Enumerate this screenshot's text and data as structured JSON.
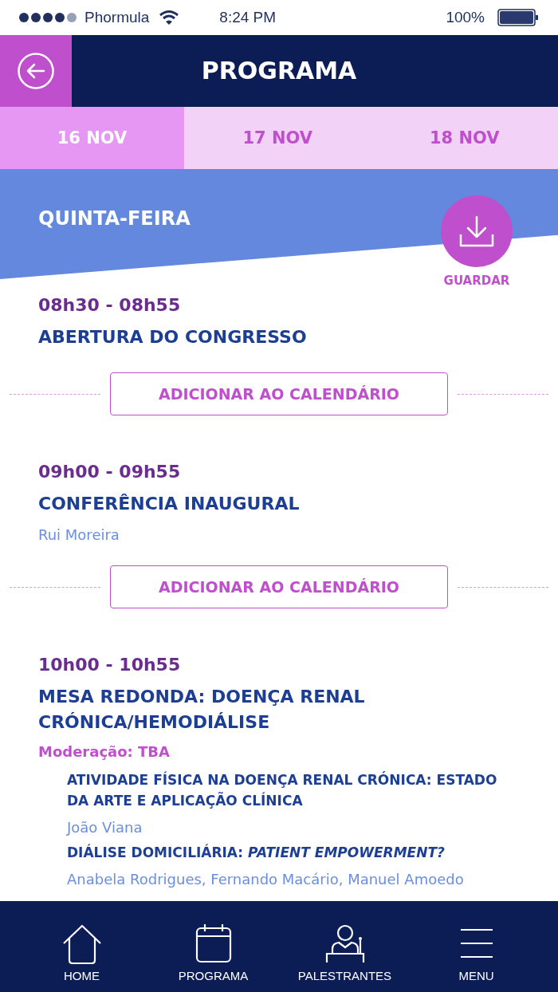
{
  "status_bar": {
    "carrier": "Phormula",
    "time": "8:24 PM",
    "battery": "100%"
  },
  "header": {
    "title": "PROGRAMA"
  },
  "tabs": [
    {
      "label": "16 NOV",
      "selected": true
    },
    {
      "label": "17 NOV",
      "selected": false
    },
    {
      "label": "18 NOV",
      "selected": false
    }
  ],
  "day": {
    "label": "QUINTA-FEIRA",
    "save_label": "GUARDAR"
  },
  "sessions": [
    {
      "time": "08h30 - 08h55",
      "title": "ABERTURA DO CONGRESSO",
      "calendar_button": "ADICIONAR AO CALENDÁRIO"
    },
    {
      "time": "09h00 - 09h55",
      "title": "CONFERÊNCIA INAUGURAL",
      "speakers": "Rui Moreira",
      "calendar_button": "ADICIONAR AO CALENDÁRIO"
    },
    {
      "time": "10h00 - 10h55",
      "title": "MESA REDONDA: DOENÇA RENAL CRÓNICA/HEMODIÁLISE",
      "moderation": "Moderação: TBA",
      "talks": [
        {
          "title": "ATIVIDADE FÍSICA NA DOENÇA RENAL CRÓNICA: ESTADO DA ARTE E APLICAÇÃO CLÍNICA",
          "speakers": "João Viana"
        },
        {
          "title": "DIÁLISE DOMICILIÁRIA: *PATIENT EMPOWERMENT?*",
          "speakers": "Anabela Rodrigues, Fernando Macário, Manuel Amoedo"
        }
      ]
    }
  ],
  "nav": [
    {
      "kind": "home",
      "label": "HOME"
    },
    {
      "kind": "calendar",
      "label": "PROGRAMA"
    },
    {
      "kind": "speaker",
      "label": "PALESTRANTES"
    },
    {
      "kind": "menu",
      "label": "MENU"
    }
  ]
}
